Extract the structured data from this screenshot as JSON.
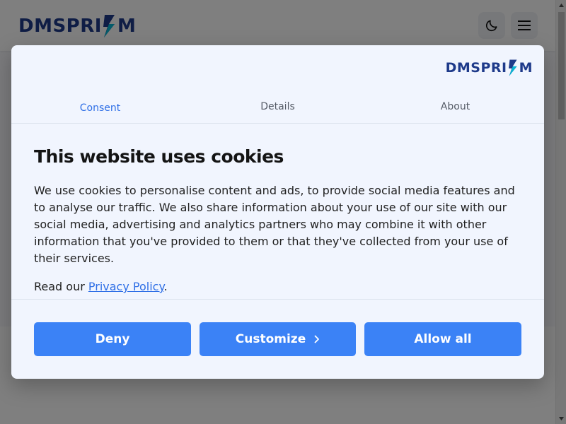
{
  "site": {
    "logo_text_left": "DMSPRI",
    "logo_text_right": "M",
    "theme_toggle_icon": "moon-icon",
    "menu_icon": "hamburger-menu-icon"
  },
  "dialog": {
    "logo_text_left": "DMSPRI",
    "logo_text_right": "M",
    "tabs": [
      {
        "label": "Consent",
        "active": true
      },
      {
        "label": "Details",
        "active": false
      },
      {
        "label": "About",
        "active": false
      }
    ],
    "title": "This website uses cookies",
    "body": "We use cookies to personalise content and ads, to provide social media features and to analyse our traffic. We also share information about your use of our site with our social media, advertising and analytics partners who may combine it with other information that you've provided to them or that they've collected from your use of their services.",
    "read_prefix": "Read our ",
    "privacy_link": "Privacy Policy",
    "read_suffix": ".",
    "buttons": {
      "deny": "Deny",
      "customize": "Customize",
      "allow_all": "Allow all"
    }
  },
  "colors": {
    "accent": "#3b82f6",
    "tab_active": "#2f6fe6",
    "logo": "#1e3a8a",
    "dialog_bg": "#f1f5fe"
  }
}
